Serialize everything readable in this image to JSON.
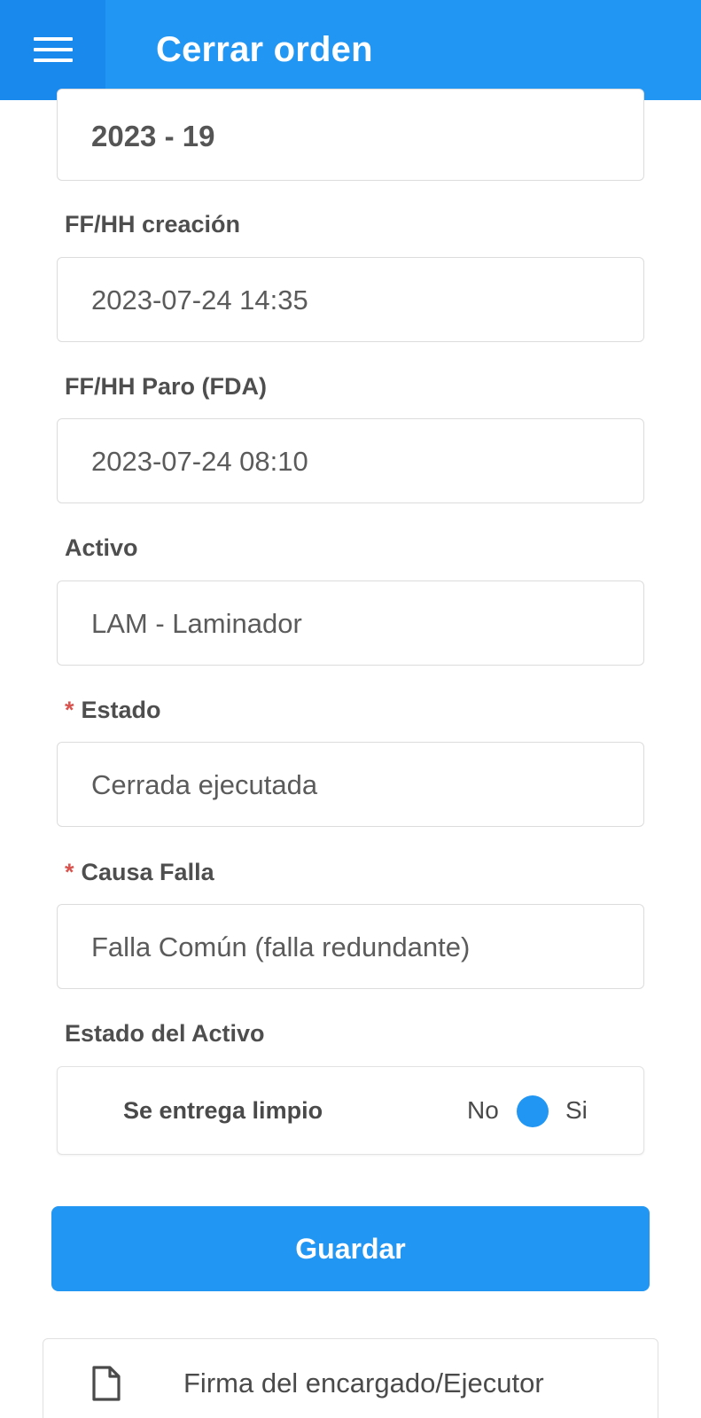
{
  "header": {
    "title": "Cerrar orden",
    "menu_icon": "hamburger-menu-icon",
    "background": "#2196f3"
  },
  "form": {
    "order_number": "2023 - 19",
    "creation": {
      "label": "FF/HH creación",
      "value": "2023-07-24 14:35"
    },
    "stop": {
      "label": "FF/HH Paro (FDA)",
      "value": "2023-07-24 08:10"
    },
    "asset": {
      "label": "Activo",
      "value": "LAM - Laminador"
    },
    "status": {
      "required_mark": "*",
      "label": "Estado",
      "value": "Cerrada ejecutada"
    },
    "failure_cause": {
      "required_mark": "*",
      "label": "Causa Falla",
      "value": "Falla Común (falla redundante)"
    },
    "asset_state": {
      "label": "Estado del Activo",
      "toggle_label": "Se entrega limpio",
      "off_label": "No",
      "on_label": "Si"
    }
  },
  "actions": {
    "save_label": "Guardar",
    "signature_label": "Firma del encargado/Ejecutor",
    "signature_icon": "document-icon"
  },
  "colors": {
    "accent": "#2196f3",
    "required": "#d9534f"
  }
}
